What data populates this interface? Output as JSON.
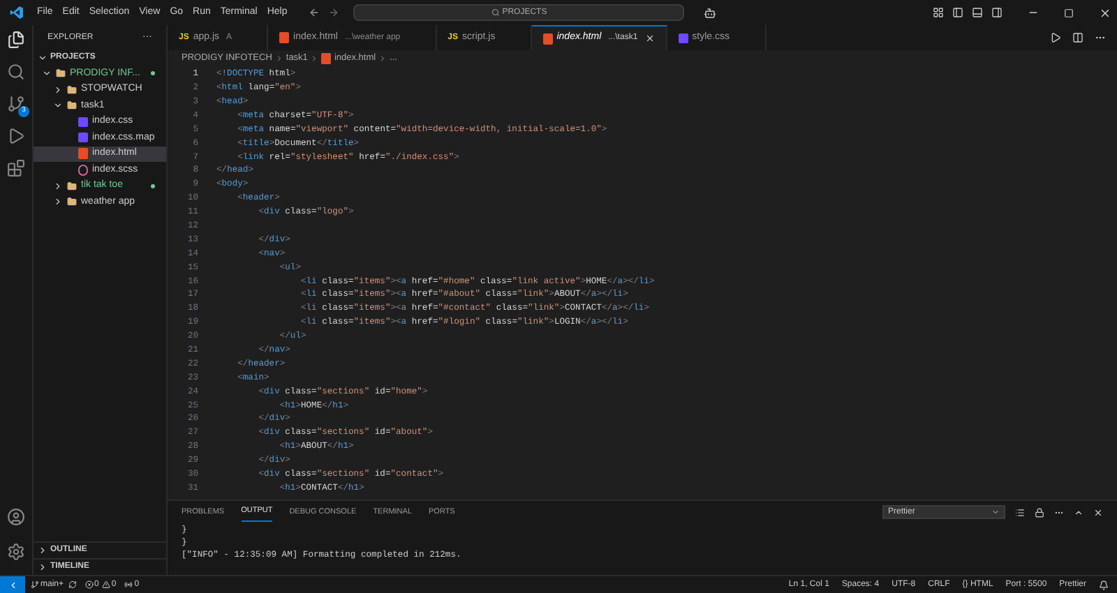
{
  "menu": [
    "File",
    "Edit",
    "Selection",
    "View",
    "Go",
    "Run",
    "Terminal",
    "Help"
  ],
  "search": {
    "value": "PROJECTS"
  },
  "activity_bar": {
    "source_control_badge": "3"
  },
  "sidebar": {
    "title": "EXPLORER",
    "more": "···",
    "section": "PROJECTS",
    "tree": [
      {
        "label": "PRODIGY INF...",
        "kind": "folder",
        "expanded": true,
        "modified": true,
        "selected": false,
        "children": [
          {
            "label": "STOPWATCH",
            "kind": "folder",
            "expanded": false,
            "modified": false,
            "selected": false
          },
          {
            "label": "task1",
            "kind": "folder",
            "expanded": true,
            "modified": false,
            "selected": false,
            "children": [
              {
                "label": "index.css",
                "kind": "css",
                "modified": false,
                "selected": false
              },
              {
                "label": "index.css.map",
                "kind": "css",
                "modified": false,
                "selected": false
              },
              {
                "label": "index.html",
                "kind": "html",
                "modified": false,
                "selected": true
              },
              {
                "label": "index.scss",
                "kind": "scss",
                "modified": false,
                "selected": false
              }
            ]
          },
          {
            "label": "tik tak toe",
            "kind": "folder",
            "expanded": false,
            "modified": true,
            "selected": false
          },
          {
            "label": "weather app",
            "kind": "folder",
            "expanded": false,
            "modified": false,
            "selected": false
          }
        ]
      }
    ],
    "bottom_sections": [
      "OUTLINE",
      "TIMELINE"
    ]
  },
  "tabs": [
    {
      "label": "app.js",
      "kind": "js",
      "icon_text": "JS",
      "suffix": "A",
      "selected": false
    },
    {
      "label": "index.html",
      "kind": "html",
      "suffix": "...\\weather app",
      "selected": false
    },
    {
      "label": "script.js",
      "kind": "js",
      "icon_text": "JS",
      "selected": false
    },
    {
      "label": "index.html",
      "kind": "html",
      "suffix": "...\\task1",
      "selected": true
    },
    {
      "label": "style.css",
      "kind": "css",
      "selected": false
    }
  ],
  "breadcrumbs": [
    "PRODIGY INFOTECH",
    "task1",
    "index.html",
    "..."
  ],
  "editor": {
    "lines": [
      {
        "number": "1",
        "text": "<!DOCTYPE html>",
        "current": true
      },
      {
        "number": "2",
        "text": "<html lang=\"en\">",
        "current": false
      },
      {
        "number": "3",
        "text": "<head>",
        "current": false
      },
      {
        "number": "4",
        "text": "    <meta charset=\"UTF-8\">",
        "current": false
      },
      {
        "number": "5",
        "text": "    <meta name=\"viewport\" content=\"width=device-width, initial-scale=1.0\">",
        "current": false
      },
      {
        "number": "6",
        "text": "    <title>Document</title>",
        "current": false
      },
      {
        "number": "7",
        "text": "    <link rel=\"stylesheet\" href=\"./index.css\">",
        "current": false
      },
      {
        "number": "8",
        "text": "</head>",
        "current": false
      },
      {
        "number": "9",
        "text": "<body>",
        "current": false
      },
      {
        "number": "10",
        "text": "    <header>",
        "current": false
      },
      {
        "number": "11",
        "text": "        <div class=\"logo\">",
        "current": false
      },
      {
        "number": "12",
        "current": false
      },
      {
        "number": "13",
        "text": "        </div>",
        "current": false
      },
      {
        "number": "14",
        "text": "        <nav>",
        "current": false
      },
      {
        "number": "15",
        "text": "            <ul>",
        "current": false
      },
      {
        "number": "16",
        "text": "                <li class=\"items\"><a href=\"#home\" class=\"link active\">HOME</a></li>",
        "current": false
      },
      {
        "number": "17",
        "text": "                <li class=\"items\"><a href=\"#about\" class=\"link\">ABOUT</a></li>",
        "current": false
      },
      {
        "number": "18",
        "text": "                <li class=\"items\"><a href=\"#contact\" class=\"link\">CONTACT</a></li>",
        "current": false
      },
      {
        "number": "19",
        "text": "                <li class=\"items\"><a href=\"#login\" class=\"link\">LOGIN</a></li>",
        "current": false
      },
      {
        "number": "20",
        "text": "            </ul>",
        "current": false
      },
      {
        "number": "21",
        "text": "        </nav>",
        "current": false
      },
      {
        "number": "22",
        "text": "    </header>",
        "current": false
      },
      {
        "number": "23",
        "text": "    <main>",
        "current": false
      },
      {
        "number": "24",
        "text": "        <div class=\"sections\" id=\"home\">",
        "current": false
      },
      {
        "number": "25",
        "text": "            <h1>HOME</h1>",
        "current": false
      },
      {
        "number": "26",
        "text": "        </div>",
        "current": false
      },
      {
        "number": "27",
        "text": "        <div class=\"sections\" id=\"about\">",
        "current": false
      },
      {
        "number": "28",
        "text": "            <h1>ABOUT</h1>",
        "current": false
      },
      {
        "number": "29",
        "text": "        </div>",
        "current": false
      },
      {
        "number": "30",
        "text": "        <div class=\"sections\" id=\"contact\">",
        "current": false
      },
      {
        "number": "31",
        "text": "            <h1>CONTACT</h1>",
        "current": false
      }
    ]
  },
  "panel": {
    "tabs": [
      {
        "label": "PROBLEMS",
        "selected": false
      },
      {
        "label": "OUTPUT",
        "selected": true
      },
      {
        "label": "DEBUG CONSOLE",
        "selected": false
      },
      {
        "label": "TERMINAL",
        "selected": false
      },
      {
        "label": "PORTS",
        "selected": false
      }
    ],
    "channel": "Prettier",
    "output": [
      "}",
      "}",
      "[\"INFO\" - 12:35:09 AM] Formatting completed in 212ms."
    ]
  },
  "status_bar": {
    "branch": "main+",
    "errors": "0",
    "warnings": "0",
    "ports": "0",
    "right": [
      "Ln 1, Col 1",
      "Spaces: 4",
      "UTF-8",
      "CRLF",
      "{} HTML",
      "Port : 5500",
      "Prettier"
    ]
  }
}
